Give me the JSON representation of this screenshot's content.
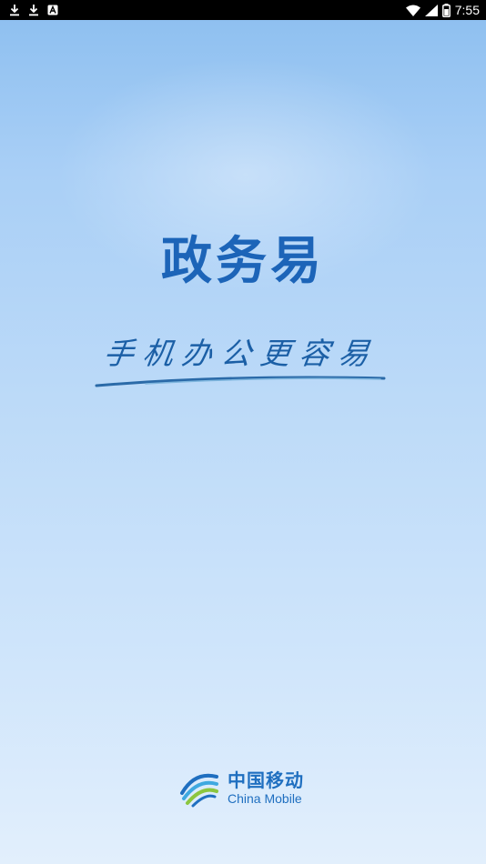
{
  "status_bar": {
    "time": "7:55",
    "left_icons": [
      "download-icon",
      "download-icon",
      "accessibility-icon"
    ],
    "right_icons": [
      "wifi-icon",
      "signal-icon",
      "battery-icon"
    ]
  },
  "splash": {
    "title": "政务易",
    "slogan": "手机办公更容易"
  },
  "brand": {
    "name_cn": "中国移动",
    "name_en": "China Mobile"
  },
  "colors": {
    "title": "#1c64b8",
    "slogan": "#1b5fa6",
    "brand": "#1f6fc0",
    "status_bar_bg": "#000000"
  }
}
